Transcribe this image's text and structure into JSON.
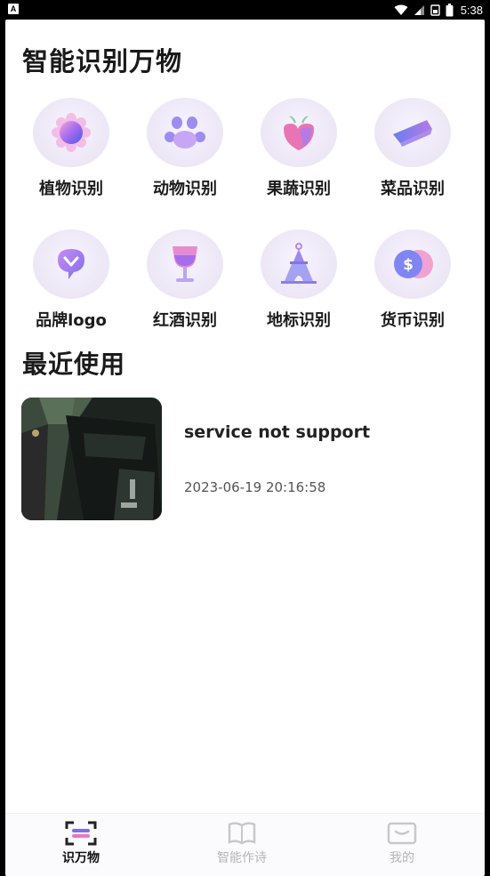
{
  "status_bar": {
    "app_badge": "A",
    "time": "5:38",
    "icons": [
      "wifi-icon",
      "signal-icon",
      "sim-icon",
      "battery-icon"
    ]
  },
  "header": {
    "title": "智能识别万物"
  },
  "categories": [
    {
      "label": "植物识别",
      "icon": "plant-icon"
    },
    {
      "label": "动物识别",
      "icon": "paw-icon"
    },
    {
      "label": "果蔬识别",
      "icon": "fruit-icon"
    },
    {
      "label": "菜品识别",
      "icon": "dish-icon"
    },
    {
      "label": "品牌logo",
      "icon": "brand-logo-icon"
    },
    {
      "label": "红酒识别",
      "icon": "wine-glass-icon"
    },
    {
      "label": "地标识别",
      "icon": "landmark-tower-icon"
    },
    {
      "label": "货币识别",
      "icon": "currency-coin-icon"
    }
  ],
  "recent": {
    "title": "最近使用",
    "items": [
      {
        "result": "service not support",
        "time": "2023-06-19 20:16:58"
      }
    ]
  },
  "tabbar": {
    "tabs": [
      {
        "label": "识万物",
        "icon": "scan-icon",
        "active": true
      },
      {
        "label": "智能作诗",
        "icon": "book-icon",
        "active": false
      },
      {
        "label": "我的",
        "icon": "profile-card-icon",
        "active": false
      }
    ]
  },
  "colors": {
    "accent_purple": "#7b6cf0",
    "accent_pink": "#e87ab8",
    "tile_bg": "#ece6f5"
  }
}
